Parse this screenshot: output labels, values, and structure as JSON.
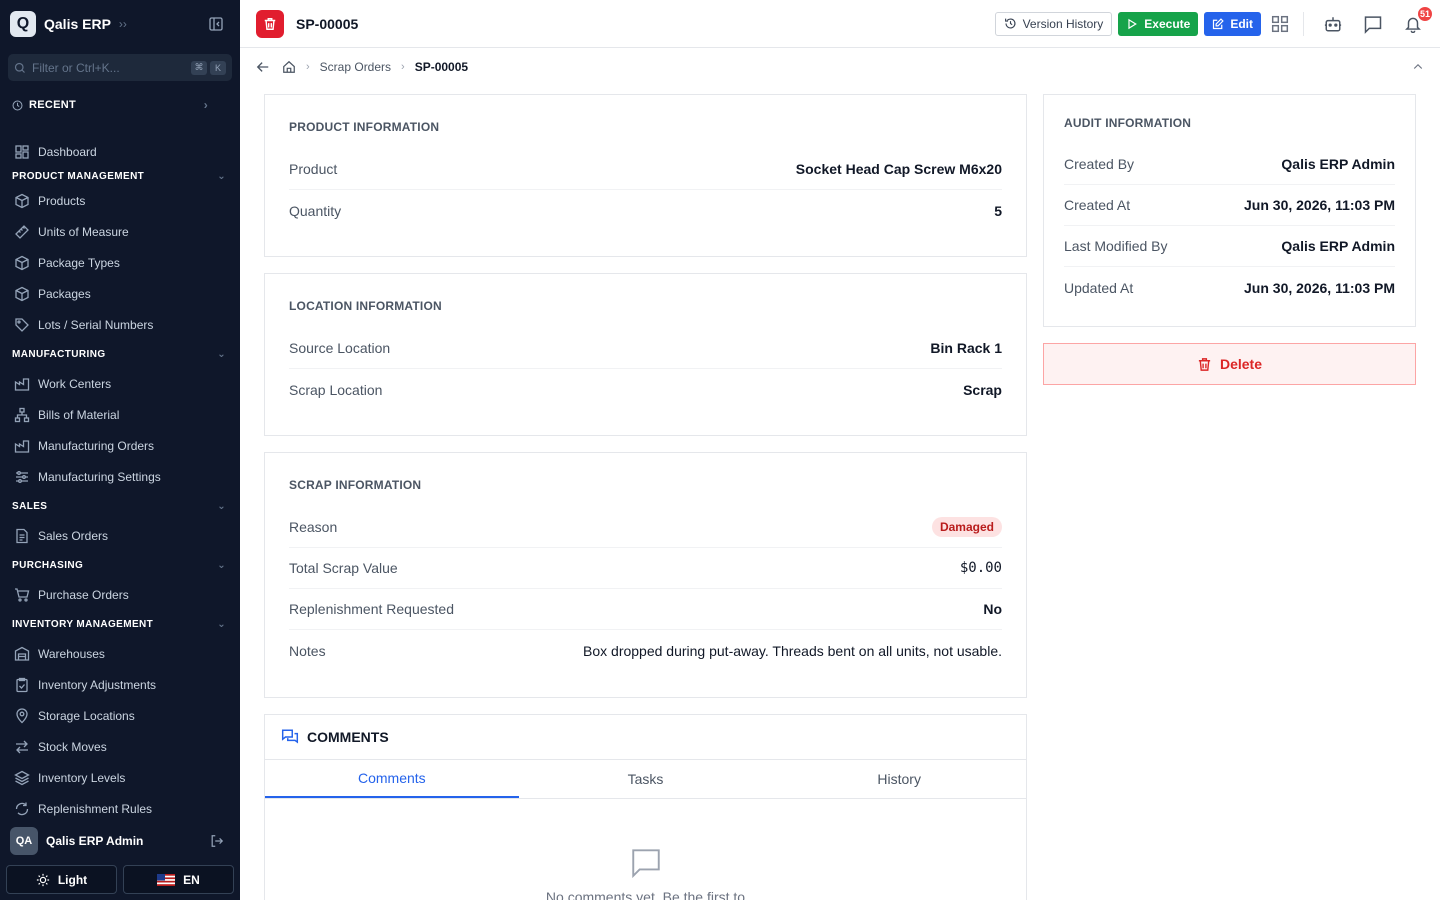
{
  "sidebar": {
    "app_name": "Qalis ERP",
    "logo_letter": "Q",
    "filter_placeholder": "Filter or Ctrl+K...",
    "kbd1": "⌘",
    "kbd2": "K",
    "recent_label": "RECENT",
    "dashboard": "Dashboard",
    "sections": {
      "product": "PRODUCT MANAGEMENT",
      "manufacturing": "MANUFACTURING",
      "sales": "SALES",
      "purchasing": "PURCHASING",
      "inventory": "INVENTORY MANAGEMENT"
    },
    "items": {
      "products": "Products",
      "uom": "Units of Measure",
      "package_types": "Package Types",
      "packages": "Packages",
      "lots": "Lots / Serial Numbers",
      "work_centers": "Work Centers",
      "bom": "Bills of Material",
      "mfg_orders": "Manufacturing Orders",
      "mfg_settings": "Manufacturing Settings",
      "sales_orders": "Sales Orders",
      "purchase_orders": "Purchase Orders",
      "warehouses": "Warehouses",
      "inv_adjustments": "Inventory Adjustments",
      "storage_locations": "Storage Locations",
      "stock_moves": "Stock Moves",
      "inv_levels": "Inventory Levels",
      "replenishment": "Replenishment Rules"
    },
    "user_initials": "QA",
    "user_name": "Qalis ERP Admin",
    "theme_label": "Light",
    "lang_label": "EN"
  },
  "header": {
    "title": "SP-00005",
    "version_history": "Version History",
    "execute": "Execute",
    "edit": "Edit",
    "notif_count": "51"
  },
  "breadcrumb": {
    "parent": "Scrap Orders",
    "current": "SP-00005"
  },
  "product_info": {
    "title": "PRODUCT INFORMATION",
    "product_label": "Product",
    "product_value": "Socket Head Cap Screw M6x20",
    "quantity_label": "Quantity",
    "quantity_value": "5"
  },
  "location_info": {
    "title": "LOCATION INFORMATION",
    "source_label": "Source Location",
    "source_value": "Bin Rack 1",
    "scrap_label": "Scrap Location",
    "scrap_value": "Scrap"
  },
  "scrap_info": {
    "title": "SCRAP INFORMATION",
    "reason_label": "Reason",
    "reason_value": "Damaged",
    "total_label": "Total Scrap Value",
    "total_value": "$0.00",
    "replenish_label": "Replenishment Requested",
    "replenish_value": "No",
    "notes_label": "Notes",
    "notes_value": "Box dropped during put-away. Threads bent on all units, not usable."
  },
  "audit_info": {
    "title": "AUDIT INFORMATION",
    "created_by_label": "Created By",
    "created_by_value": "Qalis ERP Admin",
    "created_at_label": "Created At",
    "created_at_value": "Jun 30, 2026, 11:03 PM",
    "modified_by_label": "Last Modified By",
    "modified_by_value": "Qalis ERP Admin",
    "updated_at_label": "Updated At",
    "updated_at_value": "Jun 30, 2026, 11:03 PM"
  },
  "delete_label": "Delete",
  "comments": {
    "title": "COMMENTS",
    "tabs": [
      "Comments",
      "Tasks",
      "History"
    ],
    "empty_text": "No comments yet. Be the first to"
  },
  "colors": {
    "sidebar_bg": "#0f172a",
    "accent_blue": "#2563eb",
    "execute_green": "#16a34a",
    "danger_red": "#e11d2e"
  }
}
